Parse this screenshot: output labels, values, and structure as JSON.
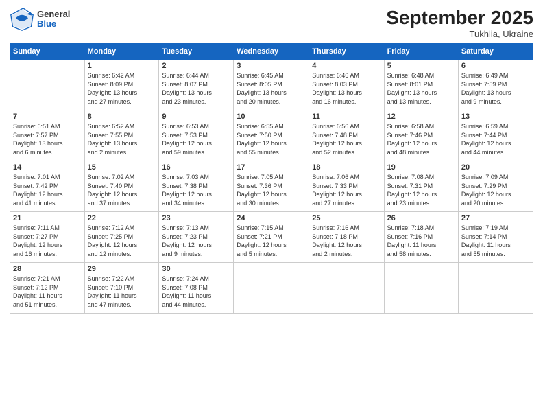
{
  "logo": {
    "general": "General",
    "blue": "Blue"
  },
  "title": {
    "month_year": "September 2025",
    "location": "Tukhlia, Ukraine"
  },
  "calendar": {
    "headers": [
      "Sunday",
      "Monday",
      "Tuesday",
      "Wednesday",
      "Thursday",
      "Friday",
      "Saturday"
    ],
    "weeks": [
      [
        {
          "day": "",
          "info": ""
        },
        {
          "day": "1",
          "info": "Sunrise: 6:42 AM\nSunset: 8:09 PM\nDaylight: 13 hours\nand 27 minutes."
        },
        {
          "day": "2",
          "info": "Sunrise: 6:44 AM\nSunset: 8:07 PM\nDaylight: 13 hours\nand 23 minutes."
        },
        {
          "day": "3",
          "info": "Sunrise: 6:45 AM\nSunset: 8:05 PM\nDaylight: 13 hours\nand 20 minutes."
        },
        {
          "day": "4",
          "info": "Sunrise: 6:46 AM\nSunset: 8:03 PM\nDaylight: 13 hours\nand 16 minutes."
        },
        {
          "day": "5",
          "info": "Sunrise: 6:48 AM\nSunset: 8:01 PM\nDaylight: 13 hours\nand 13 minutes."
        },
        {
          "day": "6",
          "info": "Sunrise: 6:49 AM\nSunset: 7:59 PM\nDaylight: 13 hours\nand 9 minutes."
        }
      ],
      [
        {
          "day": "7",
          "info": "Sunrise: 6:51 AM\nSunset: 7:57 PM\nDaylight: 13 hours\nand 6 minutes."
        },
        {
          "day": "8",
          "info": "Sunrise: 6:52 AM\nSunset: 7:55 PM\nDaylight: 13 hours\nand 2 minutes."
        },
        {
          "day": "9",
          "info": "Sunrise: 6:53 AM\nSunset: 7:53 PM\nDaylight: 12 hours\nand 59 minutes."
        },
        {
          "day": "10",
          "info": "Sunrise: 6:55 AM\nSunset: 7:50 PM\nDaylight: 12 hours\nand 55 minutes."
        },
        {
          "day": "11",
          "info": "Sunrise: 6:56 AM\nSunset: 7:48 PM\nDaylight: 12 hours\nand 52 minutes."
        },
        {
          "day": "12",
          "info": "Sunrise: 6:58 AM\nSunset: 7:46 PM\nDaylight: 12 hours\nand 48 minutes."
        },
        {
          "day": "13",
          "info": "Sunrise: 6:59 AM\nSunset: 7:44 PM\nDaylight: 12 hours\nand 44 minutes."
        }
      ],
      [
        {
          "day": "14",
          "info": "Sunrise: 7:01 AM\nSunset: 7:42 PM\nDaylight: 12 hours\nand 41 minutes."
        },
        {
          "day": "15",
          "info": "Sunrise: 7:02 AM\nSunset: 7:40 PM\nDaylight: 12 hours\nand 37 minutes."
        },
        {
          "day": "16",
          "info": "Sunrise: 7:03 AM\nSunset: 7:38 PM\nDaylight: 12 hours\nand 34 minutes."
        },
        {
          "day": "17",
          "info": "Sunrise: 7:05 AM\nSunset: 7:36 PM\nDaylight: 12 hours\nand 30 minutes."
        },
        {
          "day": "18",
          "info": "Sunrise: 7:06 AM\nSunset: 7:33 PM\nDaylight: 12 hours\nand 27 minutes."
        },
        {
          "day": "19",
          "info": "Sunrise: 7:08 AM\nSunset: 7:31 PM\nDaylight: 12 hours\nand 23 minutes."
        },
        {
          "day": "20",
          "info": "Sunrise: 7:09 AM\nSunset: 7:29 PM\nDaylight: 12 hours\nand 20 minutes."
        }
      ],
      [
        {
          "day": "21",
          "info": "Sunrise: 7:11 AM\nSunset: 7:27 PM\nDaylight: 12 hours\nand 16 minutes."
        },
        {
          "day": "22",
          "info": "Sunrise: 7:12 AM\nSunset: 7:25 PM\nDaylight: 12 hours\nand 12 minutes."
        },
        {
          "day": "23",
          "info": "Sunrise: 7:13 AM\nSunset: 7:23 PM\nDaylight: 12 hours\nand 9 minutes."
        },
        {
          "day": "24",
          "info": "Sunrise: 7:15 AM\nSunset: 7:21 PM\nDaylight: 12 hours\nand 5 minutes."
        },
        {
          "day": "25",
          "info": "Sunrise: 7:16 AM\nSunset: 7:18 PM\nDaylight: 12 hours\nand 2 minutes."
        },
        {
          "day": "26",
          "info": "Sunrise: 7:18 AM\nSunset: 7:16 PM\nDaylight: 11 hours\nand 58 minutes."
        },
        {
          "day": "27",
          "info": "Sunrise: 7:19 AM\nSunset: 7:14 PM\nDaylight: 11 hours\nand 55 minutes."
        }
      ],
      [
        {
          "day": "28",
          "info": "Sunrise: 7:21 AM\nSunset: 7:12 PM\nDaylight: 11 hours\nand 51 minutes."
        },
        {
          "day": "29",
          "info": "Sunrise: 7:22 AM\nSunset: 7:10 PM\nDaylight: 11 hours\nand 47 minutes."
        },
        {
          "day": "30",
          "info": "Sunrise: 7:24 AM\nSunset: 7:08 PM\nDaylight: 11 hours\nand 44 minutes."
        },
        {
          "day": "",
          "info": ""
        },
        {
          "day": "",
          "info": ""
        },
        {
          "day": "",
          "info": ""
        },
        {
          "day": "",
          "info": ""
        }
      ]
    ]
  }
}
